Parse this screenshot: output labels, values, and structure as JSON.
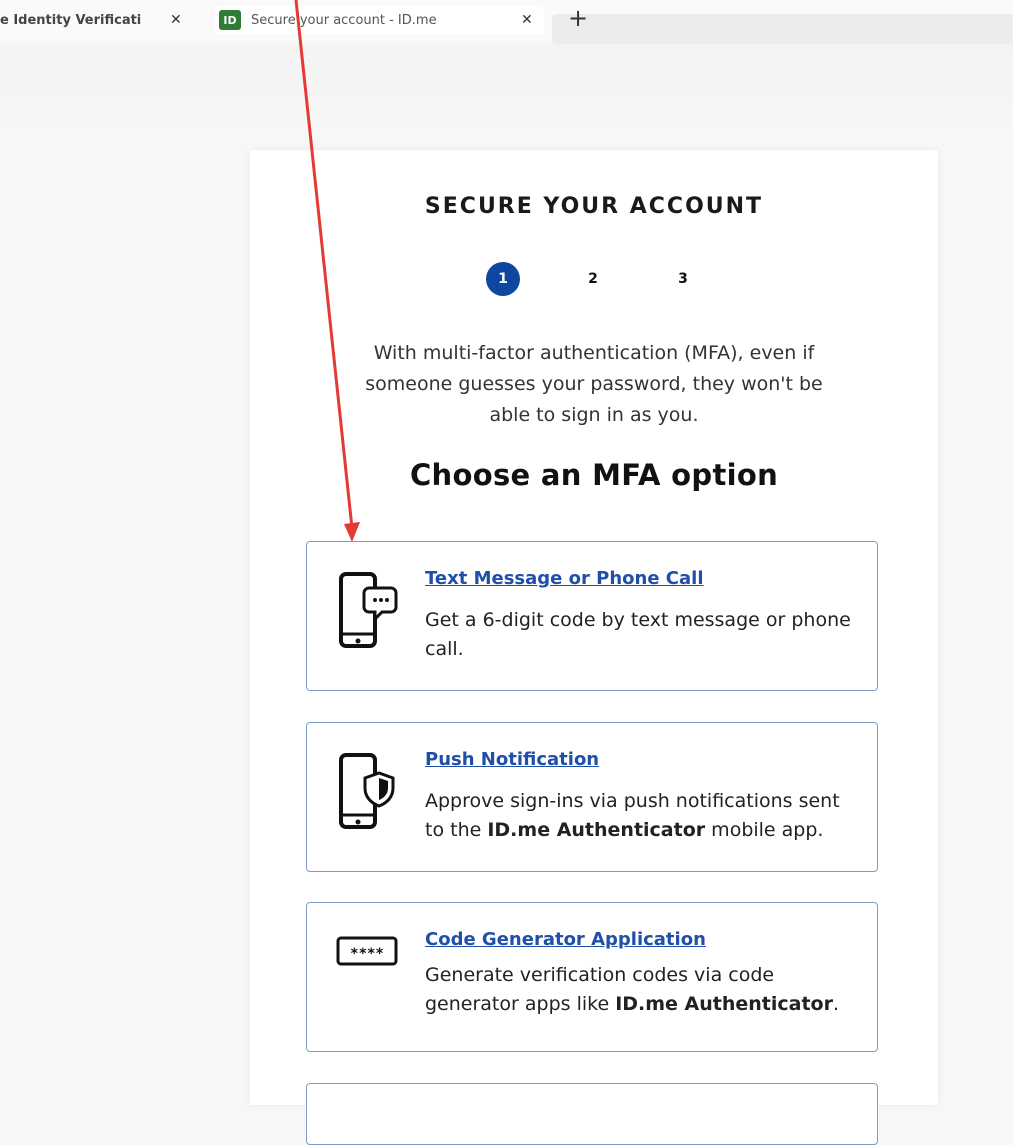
{
  "browser": {
    "tabs": [
      {
        "title": "e Identity Verificati",
        "close": "✕",
        "active": false
      },
      {
        "favicon": "ID",
        "title": "Secure your account - ID.me",
        "close": "✕",
        "active": true
      }
    ],
    "new_tab": "+"
  },
  "page": {
    "title": "SECURE YOUR ACCOUNT",
    "steps": [
      "1",
      "2",
      "3"
    ],
    "current_step": 1,
    "intro": "With multi-factor authentication (MFA), even if someone guesses your password, they won't be able to sign in as you.",
    "heading": "Choose an MFA option",
    "options": [
      {
        "icon": "phone-chat-icon",
        "title": "Text Message or Phone Call",
        "description": "Get a 6-digit code by text message or phone call."
      },
      {
        "icon": "phone-shield-icon",
        "title": "Push Notification",
        "description_pre": "Approve sign-ins via push notifications sent to the ",
        "description_bold": "ID.me Authenticator",
        "description_post": " mobile app."
      },
      {
        "icon": "code-generator-icon",
        "icon_text": "****",
        "title": "Code Generator Application",
        "description_pre": "Generate verification codes via code generator apps like ",
        "description_bold": "ID.me Authenticator",
        "description_post": "."
      }
    ]
  },
  "annotation": {
    "color": "#e53935"
  }
}
